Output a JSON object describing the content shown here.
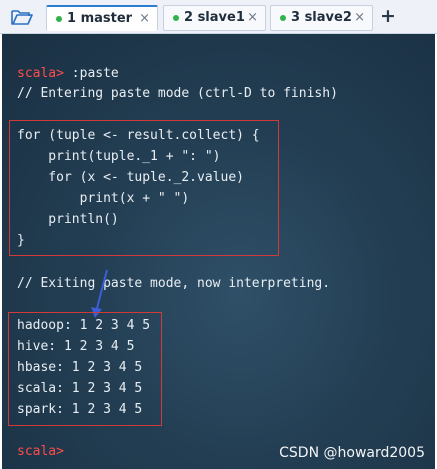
{
  "tabs": [
    {
      "label": "1 master",
      "close": "×",
      "active": true
    },
    {
      "label": "2 slave1",
      "close": "×",
      "active": false
    },
    {
      "label": "3 slave2",
      "close": "×",
      "active": false
    }
  ],
  "plus": "+",
  "terminal": {
    "prompt": "scala>",
    "paste_cmd": " :paste",
    "entering_msg": "// Entering paste mode (ctrl-D to finish)",
    "code_lines": [
      "for (tuple <- result.collect) {",
      "    print(tuple._1 + \": \")",
      "    for (x <- tuple._2.value)",
      "        print(x + \" \")",
      "    println()",
      "}"
    ],
    "exiting_msg": "// Exiting paste mode, now interpreting.",
    "output_lines": [
      "hadoop: 1 2 3 4 5",
      "hive: 1 2 3 4 5",
      "hbase: 1 2 3 4 5",
      "scala: 1 2 3 4 5",
      "spark: 1 2 3 4 5"
    ],
    "final_prompt": "scala>"
  },
  "watermark": "CSDN @howard2005",
  "colors": {
    "prompt": "#ff4d4d",
    "highlight_box": "#d23a3a",
    "arrow": "#3a5fd8",
    "active_dot": "#2fb34a"
  },
  "icons": {
    "open_folder": "folder-open-icon",
    "new_tab": "plus-icon",
    "close": "close-icon"
  }
}
